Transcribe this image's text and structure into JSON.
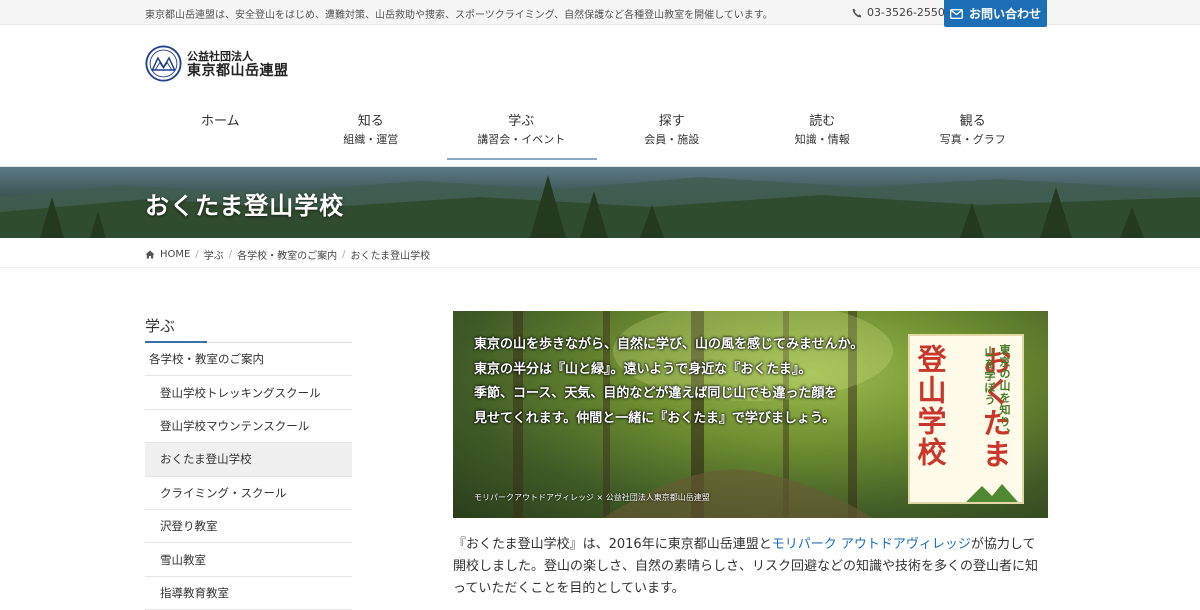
{
  "topbar": {
    "description": "東京都山岳連盟は、安全登山をはじめ、遭難対策、山岳救助や捜索、スポーツクライミング、自然保護など各種登山教室を開催しています。",
    "phone": "03-3526-2550",
    "contact_label": "お問い合わせ"
  },
  "logo": {
    "sub": "公益社団法人",
    "main": "東京都山岳連盟"
  },
  "nav": [
    {
      "main": "ホーム",
      "sub": ""
    },
    {
      "main": "知る",
      "sub": "組織・運営"
    },
    {
      "main": "学ぶ",
      "sub": "講習会・イベント"
    },
    {
      "main": "探す",
      "sub": "会員・施設"
    },
    {
      "main": "読む",
      "sub": "知識・情報"
    },
    {
      "main": "観る",
      "sub": "写真・グラフ"
    }
  ],
  "hero": {
    "title": "おくたま登山学校"
  },
  "breadcrumb": [
    "HOME",
    "学ぶ",
    "各学校・教室のご案内",
    "おくたま登山学校"
  ],
  "sidebar": {
    "title": "学ぶ",
    "items": [
      "各学校・教室のご案内",
      "登山学校トレッキングスクール",
      "登山学校マウンテンスクール",
      "おくたま登山学校",
      "クライミング・スクール",
      "沢登り教室",
      "雪山教室",
      "指導教育教室"
    ]
  },
  "banner": {
    "lines": [
      "東京の山を歩きながら、自然に学び、山の風を感じてみませんか。",
      "東京の半分は『山と緑』。遠いようで身近な『おくたま』。",
      "季節、コース、天気、目的などが違えば同じ山でも違った顔を",
      "見せてくれます。仲間と一緒に『おくたま』で学びましょう。"
    ],
    "credit": "モリパークアウトドアヴィレッジ × 公益社団法人東京都山岳連盟",
    "logo_big_1": "おくたま",
    "logo_big_2": "登山学校",
    "logo_small_1": "東京の山を知り、",
    "logo_small_2": "山を学ぼう"
  },
  "intro": {
    "before": "『おくたま登山学校』は、2016年に東京都山岳連盟と",
    "link": "モリパーク アウトドアヴィレッジ",
    "after": "が協力して開校しました。登山の楽しさ、自然の素晴らしさ、リスク回避などの知識や技術を多くの登山者に知っていただくことを目的としています。"
  }
}
